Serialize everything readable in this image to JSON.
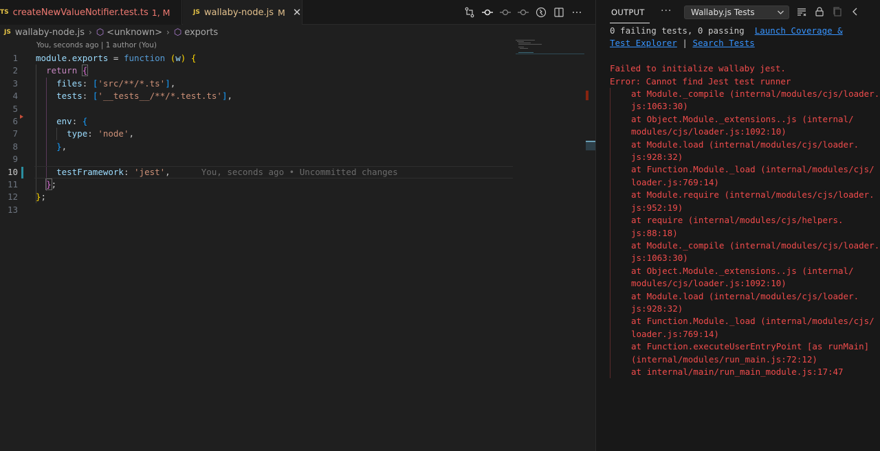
{
  "tabs": [
    {
      "ext": "TS",
      "name": "createNewValueNotifier.test.ts",
      "status": "1, M"
    },
    {
      "ext": "JS",
      "name": "wallaby-node.js",
      "status": "M",
      "close": "✕"
    }
  ],
  "breadcrumb": {
    "ext": "JS",
    "file": "wallaby-node.js",
    "symbol1": "<unknown>",
    "symbol2": "exports"
  },
  "blame_header": "You, seconds ago | 1 author (You)",
  "code": {
    "line_numbers": [
      "1",
      "2",
      "3",
      "4",
      "5",
      "6",
      "7",
      "8",
      "9",
      "10",
      "11",
      "12",
      "13"
    ],
    "active_line": "10",
    "inline_blame": "You, seconds ago • Uncommitted changes"
  },
  "output_panel": {
    "title": "OUTPUT",
    "more": "···",
    "channel": "Wallaby.js Tests",
    "summary": "0 failing tests, 0 passing",
    "link_coverage_1": "Launch Coverage &",
    "link_coverage_2": "Test Explorer",
    "separator": "|",
    "link_search": "Search Tests",
    "error_title": "Failed to initialize wallaby jest.",
    "error_message": "Error: Cannot find Jest test runner",
    "stack": [
      "at Module._compile (internal/modules/cjs/loader.",
      "js:1063:30)",
      "at Object.Module._extensions..js (internal/",
      "modules/cjs/loader.js:1092:10)",
      "at Module.load (internal/modules/cjs/loader.",
      "js:928:32)",
      "at Function.Module._load (internal/modules/cjs/",
      "loader.js:769:14)",
      "at Module.require (internal/modules/cjs/loader.",
      "js:952:19)",
      "at require (internal/modules/cjs/helpers.",
      "js:88:18)",
      "at Module._compile (internal/modules/cjs/loader.",
      "js:1063:30)",
      "at Object.Module._extensions..js (internal/",
      "modules/cjs/loader.js:1092:10)",
      "at Module.load (internal/modules/cjs/loader.",
      "js:928:32)",
      "at Function.Module._load (internal/modules/cjs/",
      "loader.js:769:14)",
      "at Function.executeUserEntryPoint [as runMain]",
      "(internal/modules/run_main.js:72:12)",
      "at internal/main/run_main_module.js:17:47"
    ]
  },
  "icons": {
    "editor_actions": [
      "git-compare-icon",
      "git-commit-icon",
      "git-prev-change-icon",
      "git-next-change-icon",
      "wallaby-icon",
      "split-editor-icon",
      "more-actions-icon"
    ],
    "panel_actions": [
      "clear-output-icon",
      "lock-scroll-icon",
      "copy-icon",
      "chevron-left-icon"
    ]
  },
  "colors": {
    "error": "#f14c4c",
    "link": "#3794ff",
    "modified_tab": "#e2c08d",
    "error_tab": "#f07a72"
  }
}
